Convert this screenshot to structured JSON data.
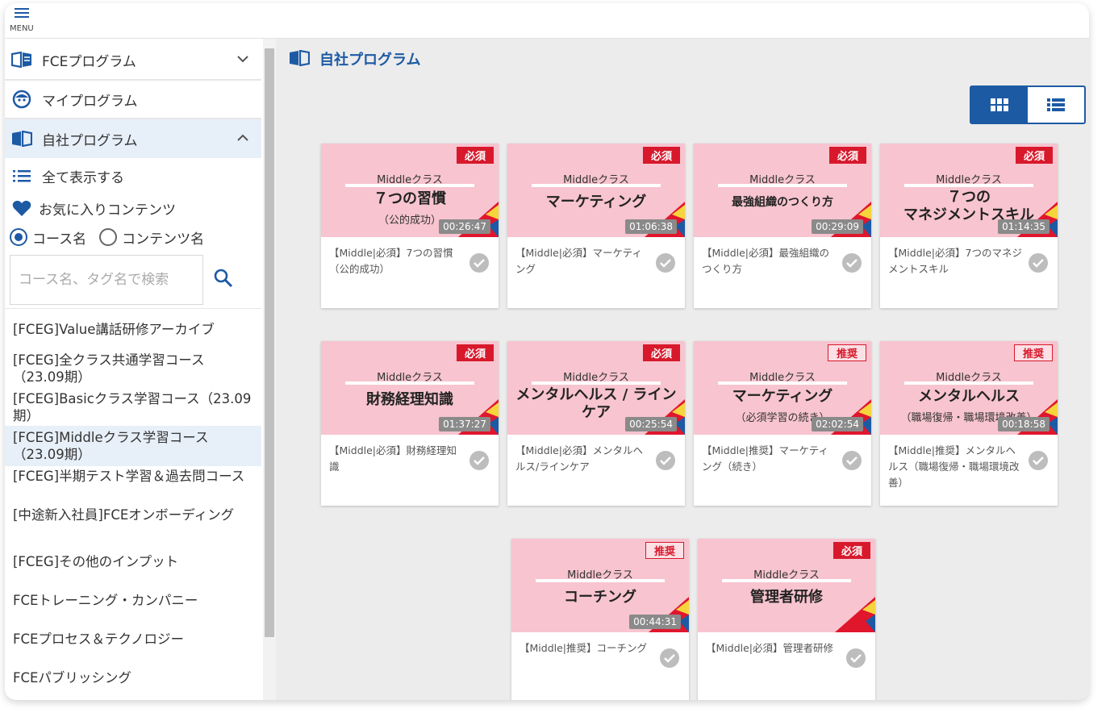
{
  "header": {
    "menu_label": "MENU"
  },
  "sidebar": {
    "fce_program": "FCEプログラム",
    "my_program": "マイプログラム",
    "company_program": "自社プログラム",
    "show_all": "全て表示する",
    "favorites": "お気に入りコンテンツ",
    "radio_course": "コース名",
    "radio_content": "コンテンツ名",
    "search_placeholder": "コース名、タグ名で検索",
    "courses": [
      "[FCEG]Value講話研修アーカイブ",
      "[FCEG]全クラス共通学習コース（23.09期）",
      "[FCEG]Basicクラス学習コース（23.09期）",
      "[FCEG]Middleクラス学習コース（23.09期）",
      "[FCEG]半期テスト学習＆過去問コース",
      "[中途新入社員]FCEオンボーディング",
      "[FCEG]その他のインプット",
      "FCEトレーニング・カンパニー",
      "FCEプロセス＆テクノロジー",
      "FCEパブリッシング"
    ]
  },
  "main": {
    "title": "自社プログラム",
    "cards": [
      {
        "badge": "必須",
        "badge_type": "required",
        "class_label": "Middleクラス",
        "title": "７つの習慣",
        "subtitle": "（公的成功）",
        "duration": "00:26:47",
        "desc": "【Middle|必須】7つの習慣（公的成功）"
      },
      {
        "badge": "必須",
        "badge_type": "required",
        "class_label": "Middleクラス",
        "title": "マーケティング",
        "subtitle": "",
        "duration": "01:06:38",
        "desc": "【Middle|必須】マーケティング"
      },
      {
        "badge": "必須",
        "badge_type": "required",
        "class_label": "Middleクラス",
        "title": "最強組織のつくり方",
        "subtitle": "",
        "duration": "00:29:09",
        "desc": "【Middle|必須】最強組織のつくり方"
      },
      {
        "badge": "必須",
        "badge_type": "required",
        "class_label": "Middleクラス",
        "title": "７つの\nマネジメントスキル",
        "subtitle": "",
        "duration": "01:14:35",
        "desc": "【Middle|必須】7つのマネジメントスキル"
      },
      {
        "badge": "必須",
        "badge_type": "required",
        "class_label": "Middleクラス",
        "title": "財務経理知識",
        "subtitle": "",
        "duration": "01:37:27",
        "desc": "【Middle|必須】財務経理知識"
      },
      {
        "badge": "必須",
        "badge_type": "required",
        "class_label": "Middleクラス",
        "title": "メンタルヘルス / ラインケア",
        "subtitle": "",
        "duration": "00:25:54",
        "desc": "【Middle|必須】メンタルヘルス/ラインケア"
      },
      {
        "badge": "推奨",
        "badge_type": "recommended",
        "class_label": "Middleクラス",
        "title": "マーケティング",
        "subtitle": "（必須学習の続き）",
        "duration": "02:02:54",
        "desc": "【Middle|推奨】マーケティング（続き）"
      },
      {
        "badge": "推奨",
        "badge_type": "recommended",
        "class_label": "Middleクラス",
        "title": "メンタルヘルス",
        "subtitle": "（職場復帰・職場環境改善）",
        "duration": "00:18:58",
        "desc": "【Middle|推奨】メンタルヘルス（職場復帰・職場環境改善）"
      },
      {
        "badge": "推奨",
        "badge_type": "recommended",
        "class_label": "Middleクラス",
        "title": "コーチング",
        "subtitle": "",
        "duration": "00:44:31",
        "desc": "【Middle|推奨】コーチング"
      },
      {
        "badge": "必須",
        "badge_type": "required",
        "class_label": "Middleクラス",
        "title": "管理者研修",
        "subtitle": "",
        "duration": "",
        "desc": "【Middle|必須】管理者研修"
      }
    ]
  },
  "colors": {
    "accent": "#1d5aa4",
    "required": "#d8192c",
    "thumb_bg": "#f7c4cf"
  },
  "icons": [
    "menu-icon",
    "book-icon",
    "chevron-down-icon",
    "face-icon",
    "chevron-up-icon",
    "list-icon",
    "heart-icon",
    "search-icon",
    "grid-view-icon",
    "list-view-icon",
    "check-icon"
  ]
}
